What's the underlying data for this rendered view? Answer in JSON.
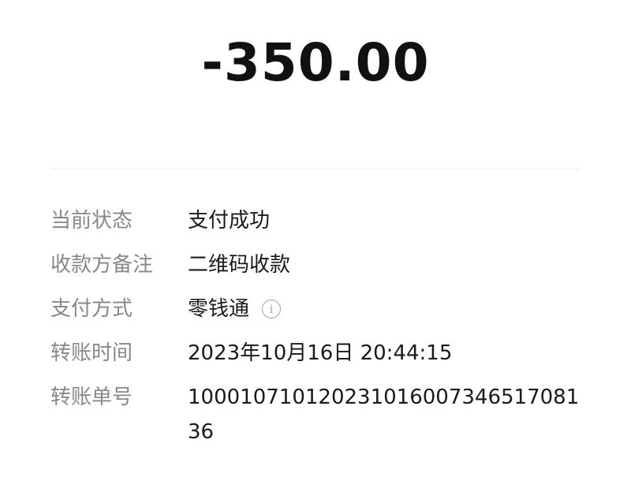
{
  "amount": "-350.00",
  "details": [
    {
      "label": "当前状态",
      "value": "支付成功"
    },
    {
      "label": "收款方备注",
      "value": "二维码收款"
    },
    {
      "label": "支付方式",
      "value": "零钱通",
      "info_icon": "info-circle-icon"
    },
    {
      "label": "转账时间",
      "value": "2023年10月16日 20:44:15"
    },
    {
      "label": "转账单号",
      "value": "100010710120231016007346517081 36"
    }
  ],
  "colors": {
    "label": "#888888",
    "value": "#1a1a1a",
    "divider": "#ececec",
    "icon": "#a6a6a6"
  }
}
